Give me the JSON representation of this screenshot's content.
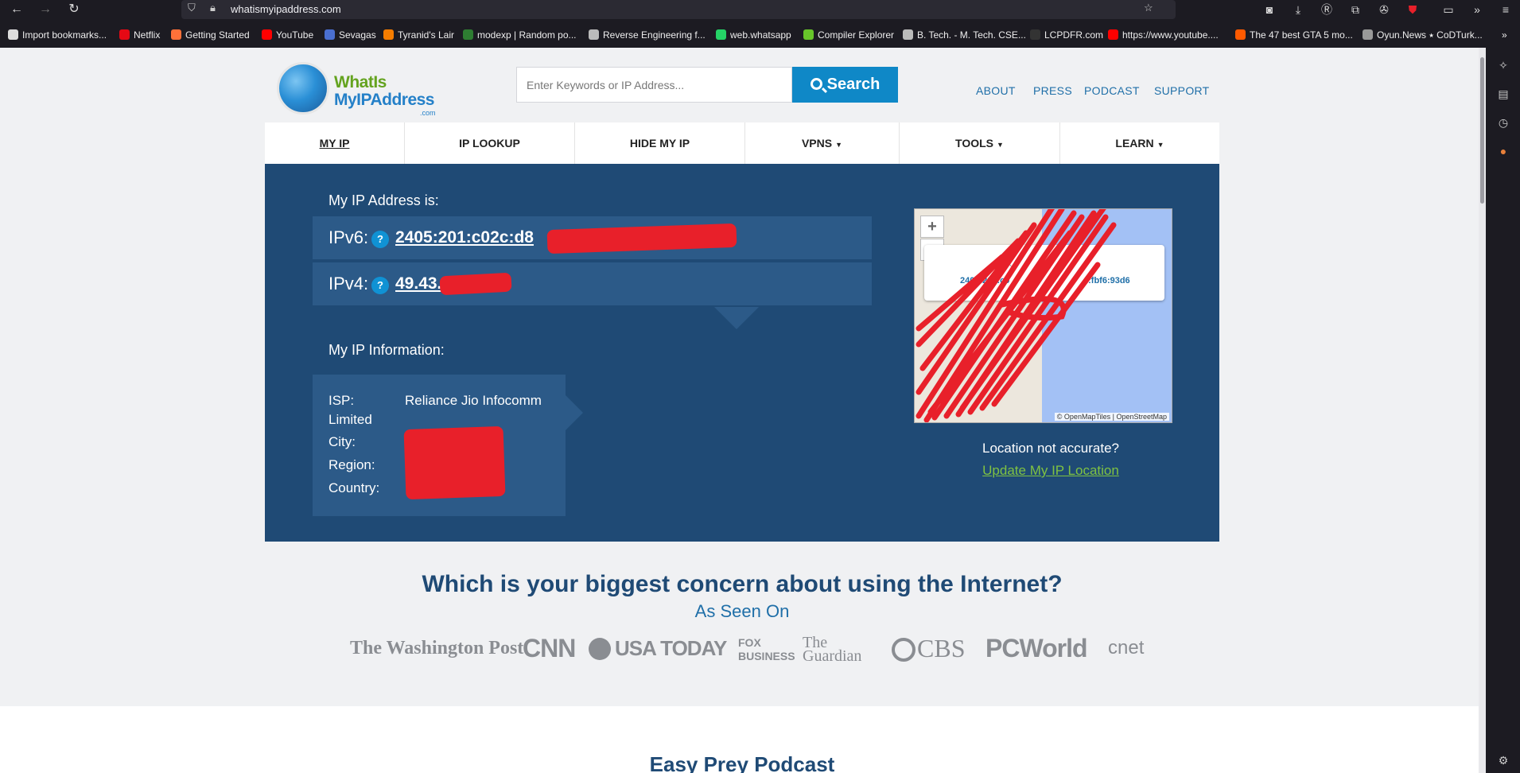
{
  "browser": {
    "url": "whatismyipaddress.com",
    "bookmarks": [
      {
        "label": "Import bookmarks...",
        "color": "#dddddd"
      },
      {
        "label": "Netflix",
        "color": "#e50914"
      },
      {
        "label": "Getting Started",
        "color": "#ff7139"
      },
      {
        "label": "YouTube",
        "color": "#ff0000"
      },
      {
        "label": "Sevagas",
        "color": "#4a6fd1"
      },
      {
        "label": "Tyranid's Lair",
        "color": "#f57d00"
      },
      {
        "label": "modexp | Random po...",
        "color": "#2e7d32"
      },
      {
        "label": "Reverse Engineering f...",
        "color": "#bbbbbb"
      },
      {
        "label": "web.whatsapp",
        "color": "#25d366"
      },
      {
        "label": "Compiler Explorer",
        "color": "#67c52a"
      },
      {
        "label": "B. Tech. - M. Tech. CSE...",
        "color": "#bbbbbb"
      },
      {
        "label": "LCPDFR.com",
        "color": "#333333"
      },
      {
        "label": "https://www.youtube....",
        "color": "#ff0000"
      },
      {
        "label": "The 47 best GTA 5 mo...",
        "color": "#ff5a00"
      },
      {
        "label": "Oyun.News ⭑ CoDTurk...",
        "color": "#999999"
      }
    ]
  },
  "header": {
    "logo": {
      "line1": "WhatIs",
      "line2": "MyIPAddress",
      "line3": ".com"
    },
    "search": {
      "placeholder": "Enter Keywords or IP Address...",
      "button_label": "Search"
    },
    "links": [
      "ABOUT",
      "PRESS",
      "PODCAST",
      "SUPPORT"
    ]
  },
  "nav": {
    "items": [
      {
        "label": "MY IP",
        "dropdown": false
      },
      {
        "label": "IP LOOKUP",
        "dropdown": false
      },
      {
        "label": "HIDE MY IP",
        "dropdown": false
      },
      {
        "label": "VPNS",
        "dropdown": true
      },
      {
        "label": "TOOLS",
        "dropdown": true
      },
      {
        "label": "LEARN",
        "dropdown": true
      }
    ]
  },
  "hero": {
    "title": "My IP Address is:",
    "ipv6_label": "IPv6:",
    "ipv6_value": "2405:201:c02c:d8",
    "ipv4_label": "IPv4:",
    "ipv4_value": "49.43.",
    "help_icon": "?",
    "info_title": "My IP Information:",
    "isp_label": "ISP:",
    "isp_value": "Reliance Jio Infocomm",
    "isp_value2": "Limited",
    "city_label": "City:",
    "region_label": "Region:",
    "country_label": "Country:",
    "map": {
      "zoom_in": "+",
      "zoom_out": "−",
      "popup_line1": "Click f",
      "popup_line2_a": "2405:201:c0",
      "popup_line2_b": "c:fbf6:93d6",
      "attribution": "© OpenMapTiles | OpenStreetMap"
    },
    "location_question": "Location not accurate?",
    "location_link": "Update My IP Location"
  },
  "concern": {
    "headline": "Which is your biggest concern about using the Internet?",
    "seen_on": "As Seen On",
    "press": [
      "The Washington Post",
      "CNN",
      "USA TODAY",
      "FOX BUSINESS",
      "The Guardian",
      "CBS",
      "PCWorld",
      "cnet"
    ]
  },
  "podcast": {
    "title": "Easy Prey Podcast"
  },
  "colors": {
    "hero": "#1f4a75",
    "accent": "#0f88c7",
    "link_green": "#7fc242",
    "redaction": "#e8202a"
  }
}
